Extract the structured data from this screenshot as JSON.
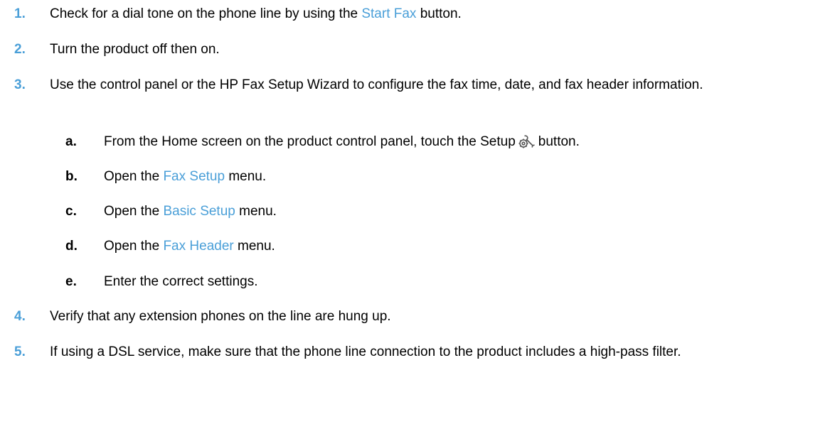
{
  "accent_color": "#4a9fd8",
  "steps": [
    {
      "num": "1.",
      "before": "Check for a dial tone on the phone line by using the ",
      "link": "Start Fax",
      "after": " button."
    },
    {
      "num": "2.",
      "text": "Turn the product off then on."
    },
    {
      "num": "3.",
      "text": "Use the control panel or the HP Fax Setup Wizard to configure the fax time, date, and fax header information."
    },
    {
      "num": "4.",
      "text": "Verify that any extension phones on the line are hung up."
    },
    {
      "num": "5.",
      "text": "If using a DSL service, make sure that the phone line connection to the product includes a high-pass filter."
    }
  ],
  "substeps": [
    {
      "num": "a.",
      "before": "From the Home screen on the product control panel, touch the Setup",
      "icon": "setup-wrench-gear-icon",
      "after": "button."
    },
    {
      "num": "b.",
      "before": "Open the ",
      "link": "Fax Setup",
      "after": " menu."
    },
    {
      "num": "c.",
      "before": "Open the ",
      "link": "Basic Setup",
      "after": " menu."
    },
    {
      "num": "d.",
      "before": "Open the ",
      "link": "Fax Header",
      "after": " menu."
    },
    {
      "num": "e.",
      "text": "Enter the correct settings."
    }
  ]
}
